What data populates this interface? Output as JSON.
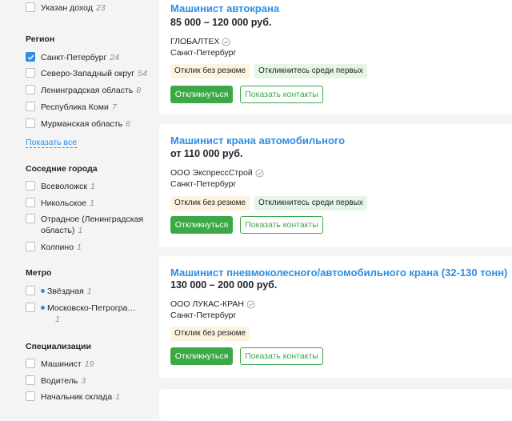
{
  "sidebar": {
    "salary_filter": {
      "label": "Указан доход",
      "count": "23"
    },
    "region": {
      "title": "Регион",
      "items": [
        {
          "label": "Санкт-Петербург",
          "count": "24",
          "checked": true
        },
        {
          "label": "Северо-Западный округ",
          "count": "54",
          "checked": false
        },
        {
          "label": "Ленинградская область",
          "count": "8",
          "checked": false
        },
        {
          "label": "Республика Коми",
          "count": "7",
          "checked": false
        },
        {
          "label": "Мурманская область",
          "count": "6",
          "checked": false
        }
      ],
      "show_all": "Показать все"
    },
    "nearby": {
      "title": "Соседние города",
      "items": [
        {
          "label": "Всеволожск",
          "count": "1"
        },
        {
          "label": "Никольское",
          "count": "1"
        },
        {
          "label_line1": "Отрадное (Ленинградская",
          "label_line2": "область)",
          "count": "1"
        },
        {
          "label": "Колпино",
          "count": "1"
        }
      ]
    },
    "metro": {
      "title": "Метро",
      "items": [
        {
          "label": "Звёздная",
          "count": "1"
        },
        {
          "label": "Московско-Петрогра…",
          "count": "1"
        }
      ],
      "dot_color": "#2e8ee6"
    },
    "specializations": {
      "title": "Специализации",
      "items": [
        {
          "label": "Машинист",
          "count": "19"
        },
        {
          "label": "Водитель",
          "count": "3"
        },
        {
          "label": "Начальник склада",
          "count": "1"
        }
      ]
    }
  },
  "vacancies": [
    {
      "title": "Машинист автокрана",
      "salary": "85 000 – 120 000 руб.",
      "company": "ГЛОБАЛТЕХ",
      "city": "Санкт-Петербург",
      "badges": [
        "Отклик без резюме",
        "Откликнитесь среди первых"
      ],
      "apply": "Откликнуться",
      "contacts": "Показать контакты"
    },
    {
      "title": "Машинист крана автомобильного",
      "salary": "от 110 000 руб.",
      "company": "ООО ЭкспрессСтрой",
      "city": "Санкт-Петербург",
      "badges": [
        "Отклик без резюме",
        "Откликнитесь среди первых"
      ],
      "apply": "Откликнуться",
      "contacts": "Показать контакты"
    },
    {
      "title": "Машинист пневмоколесного/автомобильного крана (32-130 тонн)",
      "salary": "130 000 – 200 000 руб.",
      "company": "ООО ЛУКАС-КРАН",
      "city": "Санкт-Петербург",
      "badges": [
        "Отклик без резюме"
      ],
      "apply": "Откликнуться",
      "contacts": "Показать контакты"
    }
  ],
  "colors": {
    "accent": "#2e8ee6",
    "apply_green": "#3ca847",
    "badge_orange_bg": "#fdf3df",
    "badge_green_bg": "#e6f6e6"
  },
  "icons": {
    "checkbox_checked": "check-icon",
    "verified": "verified-check-icon",
    "metro": "metro-dot-icon"
  }
}
